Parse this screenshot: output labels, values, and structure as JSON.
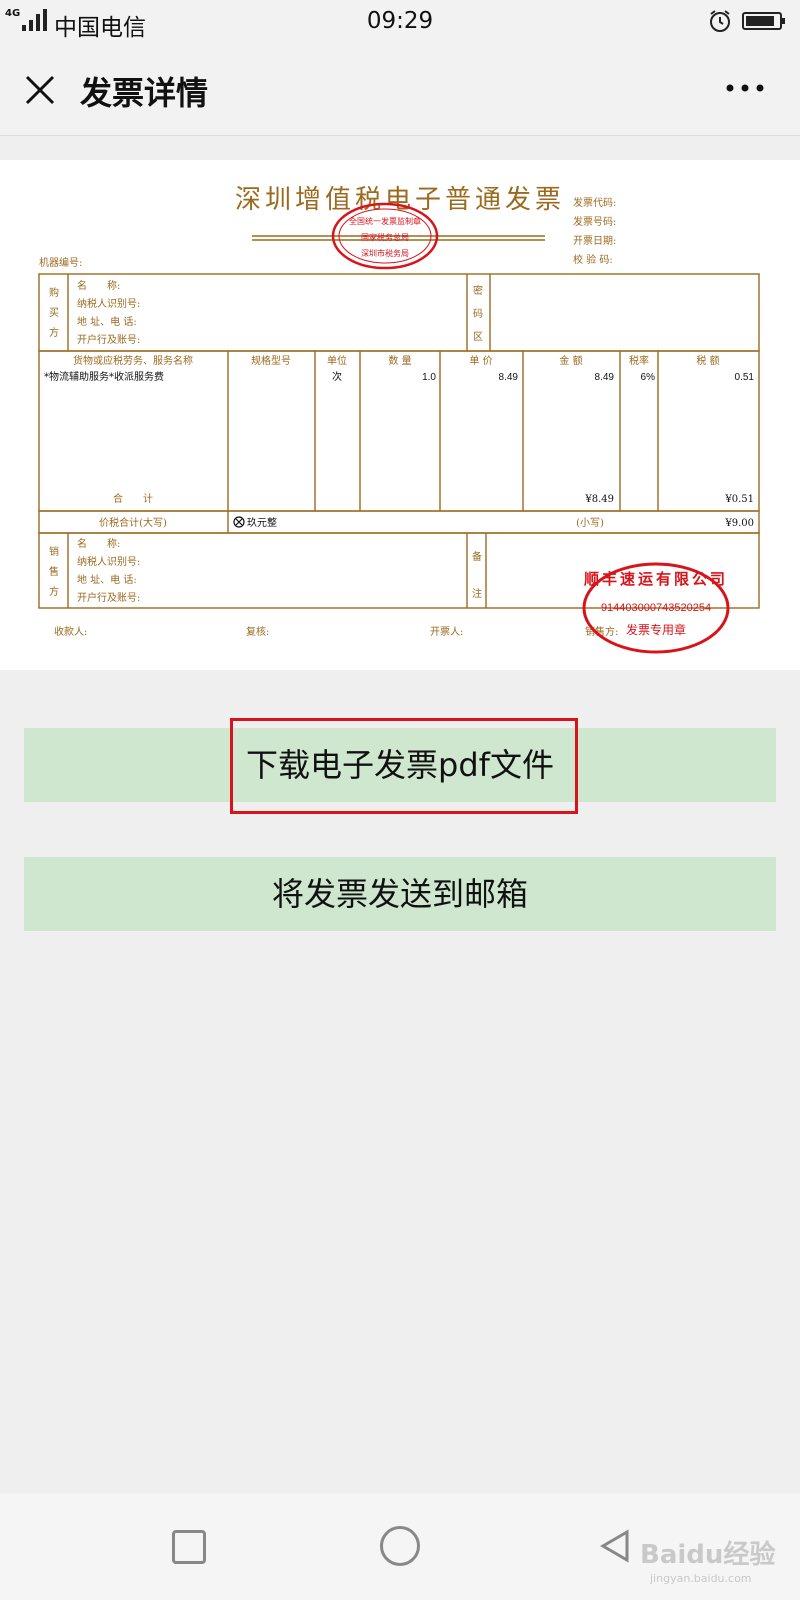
{
  "status_bar": {
    "network": "4G",
    "carrier": "中国电信",
    "time": "09:29"
  },
  "header": {
    "title": "发票详情"
  },
  "invoice": {
    "title": "深圳增值税电子普通发票",
    "seal_top": "全国统一发票监制章",
    "seal_mid": "国家税务总局",
    "seal_bottom": "深圳市税务局",
    "meta_labels": [
      "发票代码:",
      "发票号码:",
      "开票日期:",
      "校 验 码:"
    ],
    "machine_no": "机器编号:",
    "buyer_side": [
      "购",
      "买",
      "方"
    ],
    "buyer_fields": [
      "名　　称:",
      "纳税人识别号:",
      "地 址、电 话:",
      "开户行及账号:"
    ],
    "cipher_side": [
      "密",
      "码",
      "区"
    ],
    "columns": [
      "货物或应税劳务、服务名称",
      "规格型号",
      "单位",
      "数 量",
      "单 价",
      "金 额",
      "税率",
      "税 额"
    ],
    "item": {
      "name": "*物流辅助服务*收派服务费",
      "unit": "次",
      "qty": "1.0",
      "price": "8.49",
      "amount": "8.49",
      "rate": "6%",
      "tax": "0.51"
    },
    "total_label": "合　　计",
    "total_amount": "¥8.49",
    "total_tax": "¥0.51",
    "grand_label": "价税合计(大写)",
    "grand_words": "玖元整",
    "grand_small_label": "(小写)",
    "grand_small": "¥9.00",
    "seller_side": [
      "销",
      "售",
      "方"
    ],
    "seller_fields": [
      "名　　称:",
      "纳税人识别号:",
      "地 址、电 话:",
      "开户行及账号:"
    ],
    "remark_side": [
      "备",
      "注"
    ],
    "footer": [
      "收款人:",
      "复核:",
      "开票人:",
      "销售方:"
    ],
    "stamp_company": "顺丰速运有限公司",
    "stamp_taxid": "914403000743520254",
    "stamp_label": "发票专用章"
  },
  "buttons": {
    "download": "下载电子发票pdf文件",
    "email": "将发票发送到邮箱"
  },
  "watermark": {
    "text": "Baidu经验",
    "sub": "jingyan.baidu.com"
  },
  "colors": {
    "invoice_brown": "#9c6a1e",
    "stamp_red": "#d8141b",
    "button_green": "#cfe6cf"
  }
}
